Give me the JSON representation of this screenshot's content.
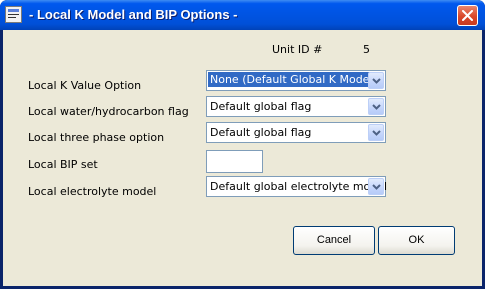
{
  "window": {
    "title": "- Local K Model and BIP Options -",
    "icon": "app-icon",
    "close_icon": "close-icon"
  },
  "unit": {
    "label": "Unit ID #",
    "value": "5"
  },
  "fields": [
    {
      "label": "Local K Value Option",
      "value": "None (Default Global K Model)",
      "selected": true
    },
    {
      "label": "Local water/hydrocarbon flag",
      "value": "Default global flag"
    },
    {
      "label": "Local three phase option",
      "value": "Default global flag"
    },
    {
      "label": "Local BIP set",
      "value": ""
    },
    {
      "label": "Local electrolyte model",
      "value": "Default global electrolyte model"
    }
  ],
  "buttons": {
    "cancel": "Cancel",
    "ok": "OK"
  },
  "colors": {
    "titlebar": "#0054e3",
    "client": "#ece9d8",
    "selection": "#316ac5",
    "close": "#d9472a"
  }
}
